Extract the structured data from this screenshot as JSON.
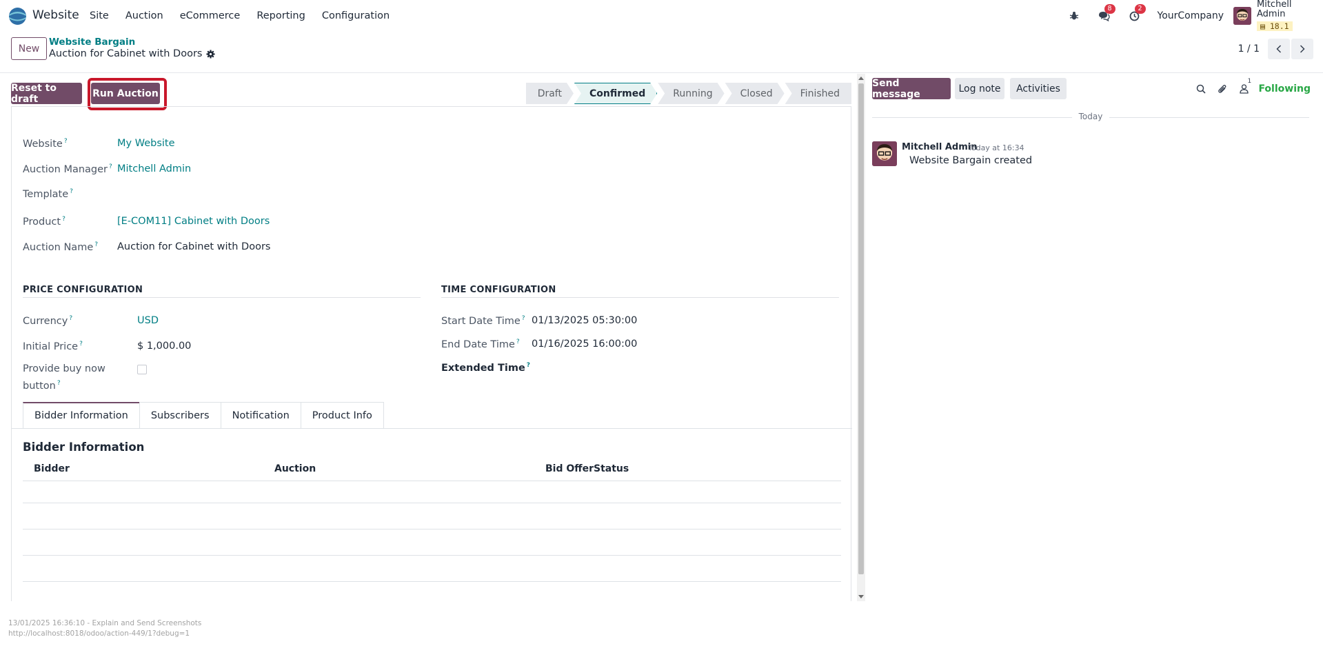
{
  "navbar": {
    "app_name": "Website",
    "menu": [
      "Site",
      "Auction",
      "eCommerce",
      "Reporting",
      "Configuration"
    ],
    "messages_count": "8",
    "activities_count": "2",
    "company": "YourCompany",
    "user_name": "Mitchell Admin",
    "db_version": "18.1"
  },
  "control_panel": {
    "new_label": "New",
    "breadcrumb_parent": "Website Bargain",
    "breadcrumb_current": "Auction for Cabinet with Doors",
    "pager": "1 / 1"
  },
  "actions": {
    "reset_label": "Reset to draft",
    "run_label": "Run Auction"
  },
  "stages": [
    {
      "label": "Draft",
      "active": false
    },
    {
      "label": "Confirmed",
      "active": true
    },
    {
      "label": "Running",
      "active": false
    },
    {
      "label": "Closed",
      "active": false
    },
    {
      "label": "Finished",
      "active": false
    }
  ],
  "fields": {
    "website_label": "Website",
    "website_value": "My Website",
    "manager_label": "Auction Manager",
    "manager_value": "Mitchell Admin",
    "template_label": "Template",
    "product_label": "Product",
    "product_value": "[E-COM11] Cabinet with Doors",
    "auction_name_label": "Auction Name",
    "auction_name_value": "Auction for Cabinet with Doors"
  },
  "price_config": {
    "title": "PRICE CONFIGURATION",
    "currency_label": "Currency",
    "currency_value": "USD",
    "initial_price_label": "Initial Price",
    "initial_price_value": "$ 1,000.00",
    "buy_now_label_1": "Provide buy now",
    "buy_now_label_2": "button",
    "buy_now_checked": false
  },
  "time_config": {
    "title": "TIME CONFIGURATION",
    "start_label": "Start Date Time",
    "start_value": "01/13/2025 05:30:00",
    "end_label": "End Date Time",
    "end_value": "01/16/2025 16:00:00",
    "extended_label": "Extended Time"
  },
  "tabs": [
    "Bidder Information",
    "Subscribers",
    "Notification",
    "Product Info"
  ],
  "bidder_section": {
    "title": "Bidder Information",
    "columns": [
      "Bidder",
      "Auction",
      "Bid Offer",
      "Status"
    ]
  },
  "chatter": {
    "send_label": "Send message",
    "log_label": "Log note",
    "activities_label": "Activities",
    "followers_count": "1",
    "following_label": "Following",
    "today_label": "Today",
    "message_author": "Mitchell Admin",
    "message_date": "Today at 16:34",
    "message_body": "Website Bargain created"
  },
  "footer": {
    "line1": "13/01/2025 16:36:10 - Explain and Send Screenshots",
    "line2": "http://localhost:8018/odoo/action-449/1?debug=1"
  },
  "colors": {
    "primary": "#714b67",
    "link": "#017e84",
    "highlight": "#c9182b",
    "following": "#28a745",
    "badge": "#dc3545"
  }
}
